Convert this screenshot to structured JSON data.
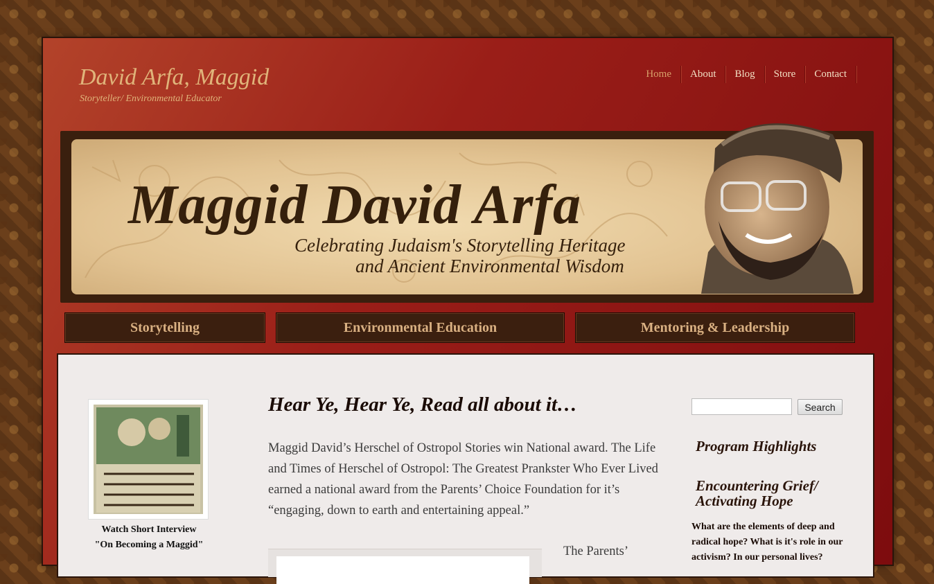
{
  "site": {
    "title": "David Arfa, Maggid",
    "tagline": "Storyteller/ Environmental Educator"
  },
  "nav": {
    "items": [
      {
        "label": "Home",
        "active": true
      },
      {
        "label": "About"
      },
      {
        "label": "Blog"
      },
      {
        "label": "Store"
      },
      {
        "label": "Contact"
      }
    ]
  },
  "banner": {
    "title": "Maggid David Arfa",
    "subtitle_line1": "Celebrating Judaism's Storytelling Heritage",
    "subtitle_line2": "and Ancient Environmental Wisdom"
  },
  "categories": [
    "Storytelling",
    "Environmental Education",
    "Mentoring & Leadership"
  ],
  "left_sidebar": {
    "caption_line1": "Watch Short Interview",
    "caption_line2": "\"On Becoming a Maggid\""
  },
  "post": {
    "title": "Hear Ye, Hear Ye, Read all about it…",
    "body": "Maggid David’s Herschel of Ostropol Stories win National award. The Life and Times of Herschel of Ostropol: The Greatest Prankster Who Ever Lived earned a national award from the Parents’ Choice Foundation for it’s “engaging, down to earth and entertaining appeal.”",
    "continued": "The Parents’"
  },
  "right_sidebar": {
    "search_placeholder": "",
    "search_button": "Search",
    "heading1": "Program Highlights",
    "heading2_line1": "Encountering Grief/",
    "heading2_line2": "Activating Hope",
    "text": "What are the elements of deep and radical hope? What is it's role in our activism? In our personal lives?"
  },
  "colors": {
    "background": "#4a2a12",
    "header_red": "#9a1e18",
    "accent_gold": "#e0b47a",
    "button_brown": "#3b1f0f",
    "content_bg": "#efebea"
  }
}
